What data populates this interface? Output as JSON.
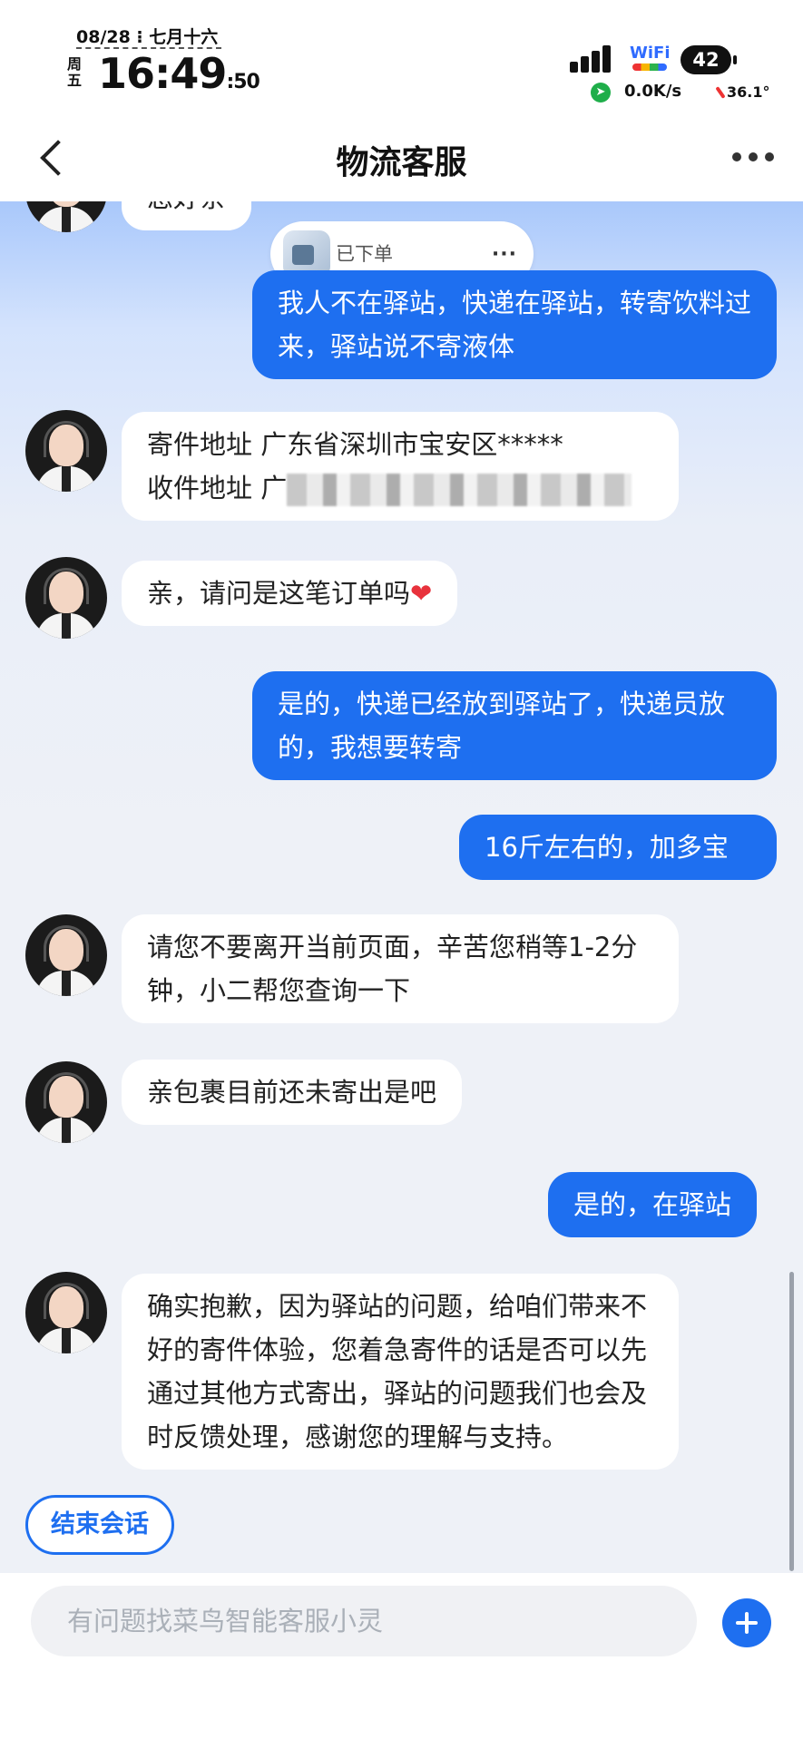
{
  "status_bar": {
    "date": "08/28 ⁝ 七月十六",
    "weekday": "周五",
    "time_main": "16:49",
    "time_seconds": ":50",
    "wifi_label": "WiFi",
    "battery": "42",
    "net_speed": "0.0K/s",
    "temperature": "36.1°"
  },
  "header": {
    "title": "物流客服"
  },
  "chat": {
    "top_partial": "您好亲",
    "order_card_label": "已下单",
    "order_card_more": "···",
    "messages": [
      {
        "from": "user",
        "text": "我人不在驿站，快递在驿站，转寄饮料过来，驿站说不寄液体"
      },
      {
        "from": "agent",
        "line1": "寄件地址 广东省深圳市宝安区*****",
        "line2": "收件地址 广"
      },
      {
        "from": "agent",
        "text": "亲，请问是这笔订单吗",
        "emoji": "❤"
      },
      {
        "from": "user",
        "text": "是的，快递已经放到驿站了，快递员放的，我想要转寄"
      },
      {
        "from": "user",
        "text": "16斤左右的，加多宝"
      },
      {
        "from": "agent",
        "text": "请您不要离开当前页面，辛苦您稍等1-2分钟，小二帮您查询一下"
      },
      {
        "from": "agent",
        "text": "亲包裹目前还未寄出是吧"
      },
      {
        "from": "user",
        "text": "是的，在驿站"
      },
      {
        "from": "agent",
        "text": "确实抱歉，因为驿站的问题，给咱们带来不好的寄件体验，您着急寄件的话是否可以先通过其他方式寄出，驿站的问题我们也会及时反馈处理，感谢您的理解与支持。"
      }
    ],
    "end_session_label": "结束会话"
  },
  "input_bar": {
    "placeholder": "有问题找菜鸟智能客服小灵"
  },
  "colors": {
    "accent": "#1e6ff0",
    "incoming_bubble": "#ffffff",
    "background": "#eef1f7"
  }
}
